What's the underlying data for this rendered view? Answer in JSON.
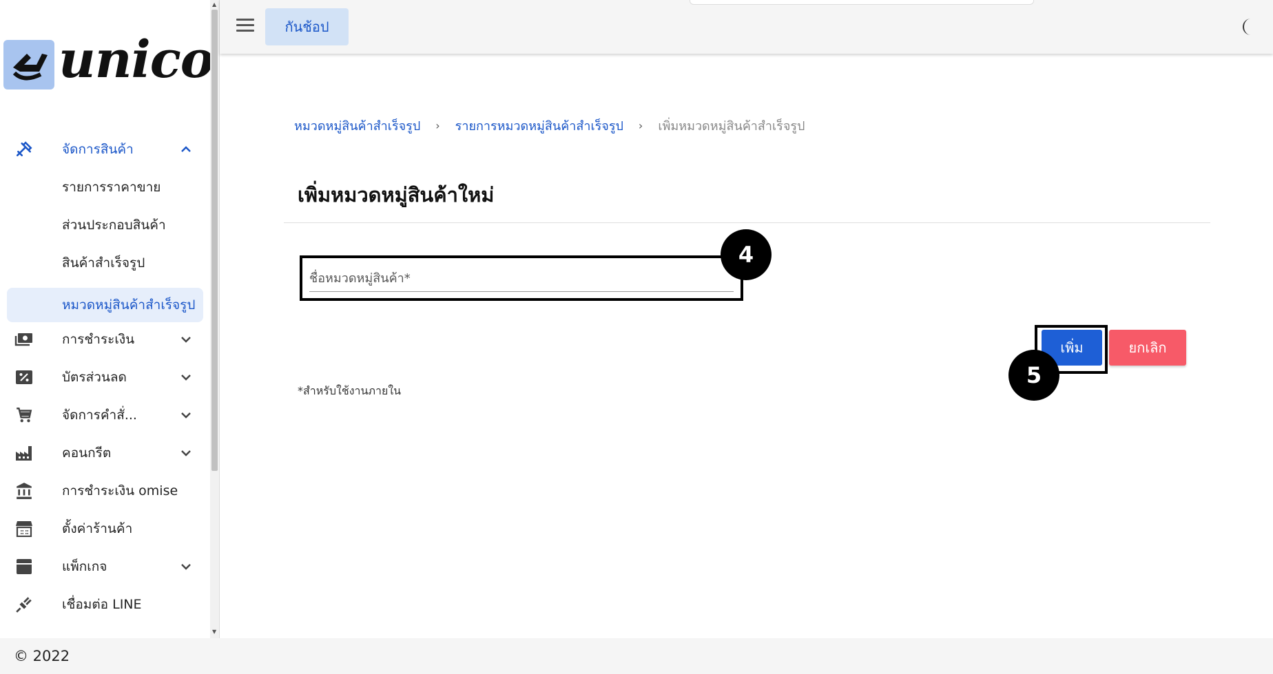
{
  "app": {
    "logo_text": "unicon"
  },
  "topbar": {
    "shop_button": "กันช้อป"
  },
  "sidebar": {
    "items": [
      {
        "label": "จัดการสินค้า",
        "icon": "tools-icon",
        "expanded": true
      },
      {
        "label": "รายการราคาขาย"
      },
      {
        "label": "ส่วนประกอบสินค้า"
      },
      {
        "label": "สินค้าสำเร็จรูป"
      },
      {
        "label": "หมวดหมู่สินค้าสำเร็จรูป",
        "active": true
      },
      {
        "label": "การชำระเงิน",
        "icon": "payments-icon"
      },
      {
        "label": "บัตรส่วนลด",
        "icon": "discount-icon"
      },
      {
        "label": "จัดการคำสั่...",
        "icon": "cart-icon"
      },
      {
        "label": "คอนกรีต",
        "icon": "factory-icon"
      },
      {
        "label": "การชำระเงิน omise",
        "icon": "bank-icon"
      },
      {
        "label": "ตั้งค่าร้านค้า",
        "icon": "store-icon"
      },
      {
        "label": "แพ็กเกจ",
        "icon": "package-icon"
      },
      {
        "label": "เชื่อมต่อ LINE",
        "icon": "plug-icon"
      }
    ]
  },
  "breadcrumb": {
    "items": [
      "หมวดหมู่สินค้าสำเร็จรูป",
      "รายการหมวดหมู่สินค้าสำเร็จรูป",
      "เพิ่มหมวดหมู่สินค้าสำเร็จรูป"
    ],
    "separator": "›"
  },
  "page": {
    "title": "เพิ่มหมวดหมู่สินค้าใหม่",
    "field_placeholder": "ชื่อหมวดหมู่สินค้า*",
    "note": "*สำหรับใช้งานภายใน"
  },
  "actions": {
    "add": "เพิ่ม",
    "cancel": "ยกเลิก"
  },
  "annotations": {
    "step_field": "4",
    "step_add": "5"
  },
  "footer": {
    "copyright": "© 2022"
  },
  "colors": {
    "accent": "#1a56c8",
    "add_button": "#1e5fd6",
    "cancel_button": "#f75a68",
    "active_bg": "#e6eefb"
  }
}
